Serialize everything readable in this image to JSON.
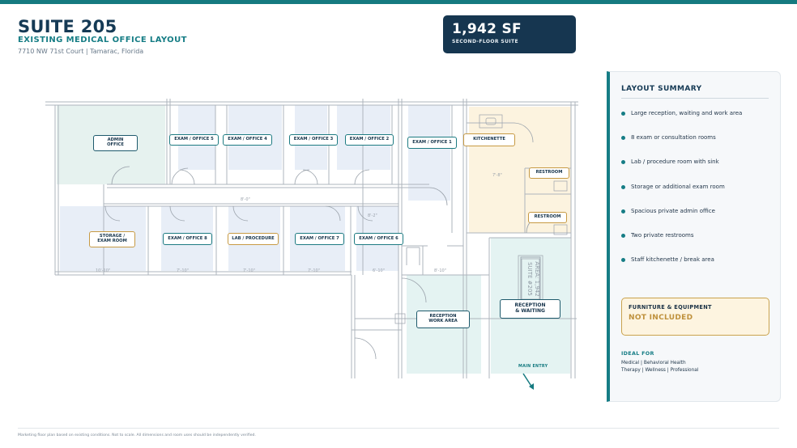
{
  "header": {
    "title": "SUITE 205",
    "subtitle": "EXISTING MEDICAL OFFICE LAYOUT",
    "address": "7710 NW 71st Court | Tamarac, Florida"
  },
  "square_footage": {
    "value": "1,942 SF",
    "label": "SECOND-FLOOR SUITE"
  },
  "floor_plan": {
    "rooms": {
      "admin_office": "ADMIN\nOFFICE",
      "exam_office_5": "EXAM / OFFICE 5",
      "exam_office_4": "EXAM / OFFICE 4",
      "exam_office_3": "EXAM / OFFICE 3",
      "exam_office_2": "EXAM / OFFICE 2",
      "exam_office_1": "EXAM / OFFICE 1",
      "kitchenette": "KITCHENETTE",
      "restroom_1": "RESTROOM",
      "restroom_2": "RESTROOM",
      "storage_exam": "STORAGE /\nEXAM ROOM",
      "exam_office_8": "EXAM / OFFICE 8",
      "lab_procedure": "LAB / PROCEDURE",
      "exam_office_7": "EXAM / OFFICE 7",
      "exam_office_6": "EXAM / OFFICE 6",
      "reception_work": "RECEPTION\nWORK AREA",
      "reception_waiting": "RECEPTION\n& WAITING"
    },
    "main_entry": "MAIN ENTRY",
    "stamp_line_1": "SUITE #205",
    "stamp_line_2": "AREA: 1,942",
    "colors": {
      "exam_fill": "#e8eef7",
      "reception_fill": "#e4f3f2",
      "service_fill": "#fcf3df",
      "wall": "#aeb4bc"
    }
  },
  "summary": {
    "title": "LAYOUT SUMMARY",
    "items": [
      "Large reception, waiting and work area",
      "8 exam or consultation rooms",
      "Lab / procedure room with sink",
      "Storage or additional exam room",
      "Spacious private admin office",
      "Two private restrooms",
      "Staff kitchenette / break area"
    ],
    "furniture_title": "FURNITURE & EQUIPMENT",
    "furniture_value": "NOT INCLUDED",
    "ideal_title": "IDEAL FOR",
    "ideal_line_1": "Medical | Behavioral Health",
    "ideal_line_2": "Therapy | Wellness | Professional"
  },
  "footer": {
    "note": "Marketing floor plan based on existing conditions. Not to scale. All dimensions and room uses should be independently verified."
  },
  "brand_colors": {
    "teal": "#167d85",
    "navy": "#153a55",
    "gold": "#c79a44"
  }
}
